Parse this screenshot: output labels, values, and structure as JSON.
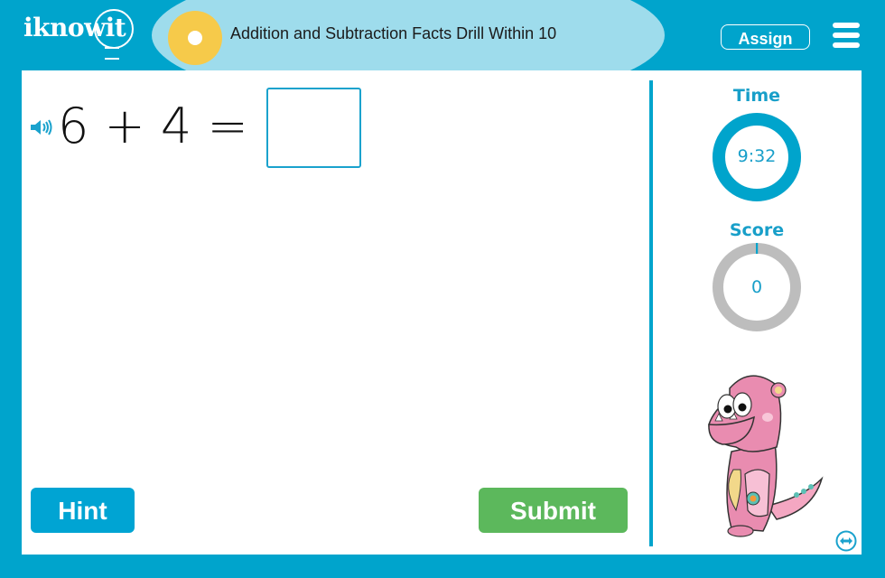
{
  "header": {
    "logo_text": "iknowit",
    "title": "Addition and Subtraction Facts Drill Within 10",
    "assign_label": "Assign",
    "menu_icon": "hamburger-menu-icon"
  },
  "question": {
    "text": "6 + 4 =",
    "answer_value": "",
    "sound_icon": "speaker-icon"
  },
  "buttons": {
    "hint_label": "Hint",
    "submit_label": "Submit"
  },
  "stats": {
    "time_label": "Time",
    "time_value": "9:32",
    "time_progress": 1.0,
    "score_label": "Score",
    "score_value": "0",
    "score_progress": 0.0
  },
  "colors": {
    "brand_blue": "#00a4cc",
    "title_band": "#9edcec",
    "disc_yellow": "#f6ca4a",
    "submit_green": "#5cb85c",
    "ring_gray": "#bdbdbd"
  },
  "footer": {
    "swap_icon": "swap-horizontal-icon"
  }
}
